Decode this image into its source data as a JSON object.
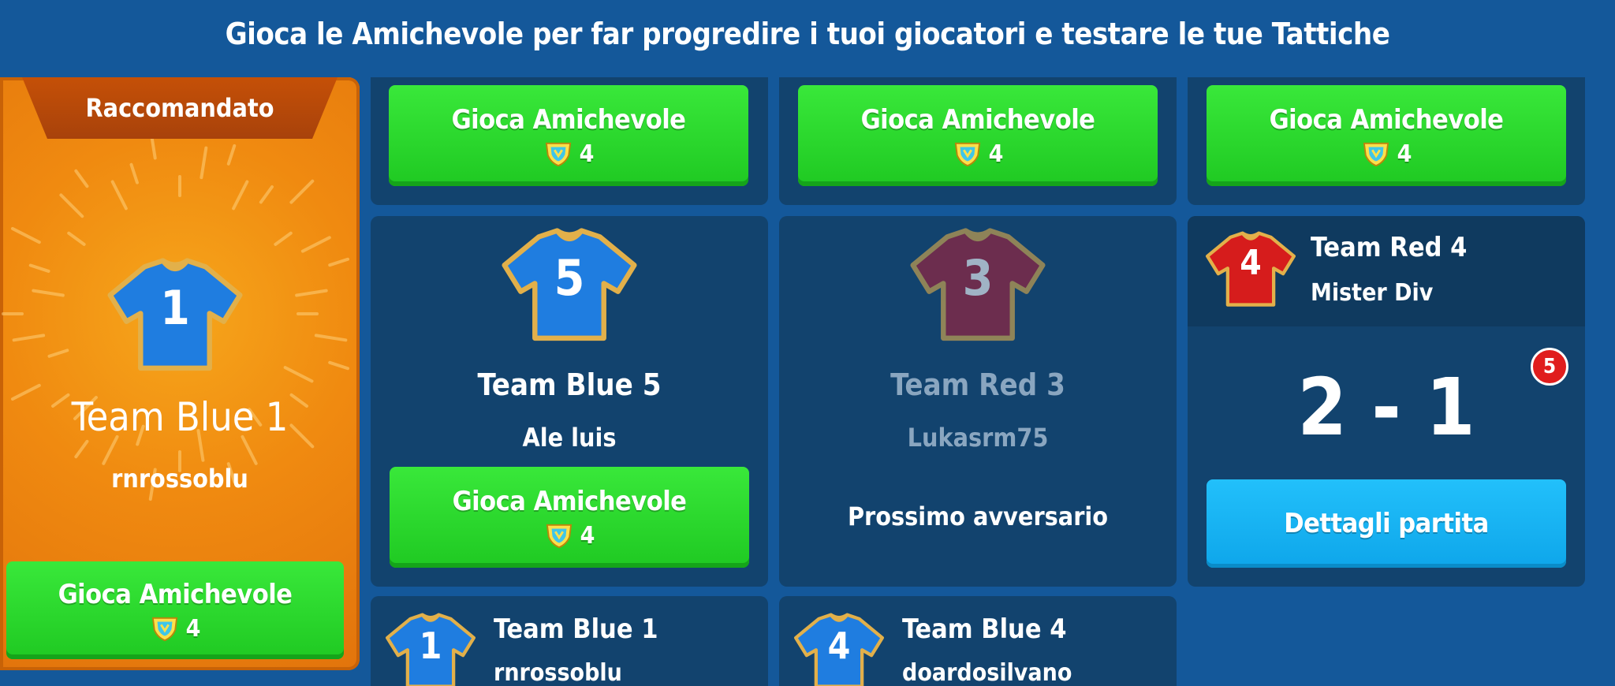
{
  "header": {
    "title": "Gioca le Amichevole per far progredire i tuoi giocatori e testare le tue Tattiche"
  },
  "play_label": "Gioca Amichevole",
  "play_cost": "4",
  "recommended": {
    "ribbon": "Raccomandato",
    "shirt_number": "1",
    "team": "Team Blue 1",
    "manager": "rnrossoblu"
  },
  "cards": {
    "team_blue_5": {
      "shirt_number": "5",
      "team": "Team Blue 5",
      "manager": "Ale luis"
    },
    "team_red_3": {
      "shirt_number": "3",
      "team": "Team Red 3",
      "manager": "Lukasrm75",
      "status": "Prossimo avversario"
    },
    "team_red_4": {
      "shirt_number": "4",
      "team": "Team Red 4",
      "manager": "Mister Div",
      "score": "2 - 1",
      "badge": "5",
      "details_label": "Dettagli partita"
    },
    "team_blue_1_bottom": {
      "shirt_number": "1",
      "team": "Team Blue 1",
      "manager": "rnrossoblu"
    },
    "team_blue_4": {
      "shirt_number": "4",
      "team": "Team Blue 4",
      "manager": "doardosilvano"
    }
  },
  "colors": {
    "bg": "#14589a",
    "card": "#12436e",
    "green": "#22cc22",
    "blue_button": "#12b1f4",
    "orange": "#f08a10",
    "badge_red": "#e01d1d"
  },
  "icons": {
    "cost": "energy-shield-icon",
    "shirt": "jersey-icon"
  }
}
